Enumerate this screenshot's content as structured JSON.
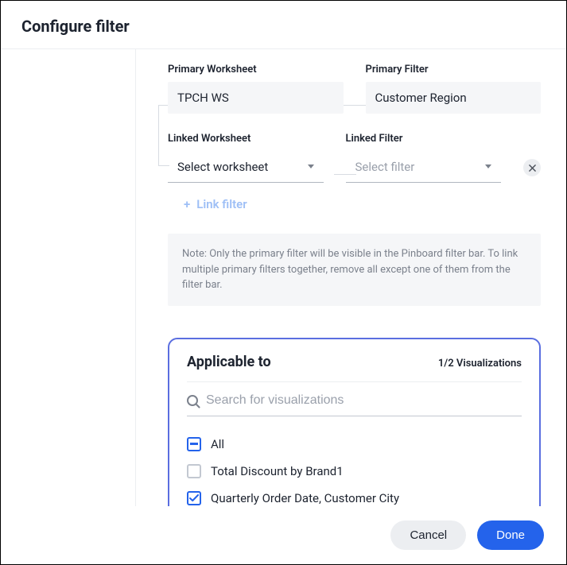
{
  "header": {
    "title": "Configure filter"
  },
  "primary": {
    "worksheet_label": "Primary Worksheet",
    "worksheet_value": "TPCH WS",
    "filter_label": "Primary Filter",
    "filter_value": "Customer Region"
  },
  "linked": {
    "worksheet_label": "Linked Worksheet",
    "worksheet_placeholder": "Select worksheet",
    "filter_label": "Linked Filter",
    "filter_placeholder": "Select filter"
  },
  "link_filter_label": "Link filter",
  "note": "Note: Only the primary filter will be visible in the Pinboard filter bar. To link multiple primary filters together, remove all except one of them from the filter bar.",
  "applicable": {
    "title": "Applicable to",
    "count_label": "1/2 Visualizations",
    "search_placeholder": "Search for visualizations",
    "items": [
      {
        "label": "All",
        "state": "indeterminate"
      },
      {
        "label": "Total Discount by Brand1",
        "state": "unchecked"
      },
      {
        "label": "Quarterly Order Date, Customer City",
        "state": "checked"
      }
    ]
  },
  "footer": {
    "cancel": "Cancel",
    "done": "Done"
  }
}
